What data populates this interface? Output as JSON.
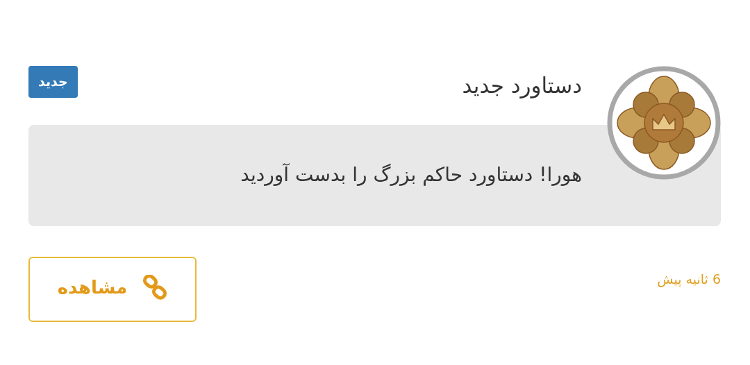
{
  "notification": {
    "title": "دستاورد جدید",
    "badge": "جدید",
    "message": "هورا! دستاورد حاکم بزرگ را بدست آوردید",
    "time": "6 ثانیه پیش",
    "button": {
      "label": "مشاهده"
    }
  }
}
